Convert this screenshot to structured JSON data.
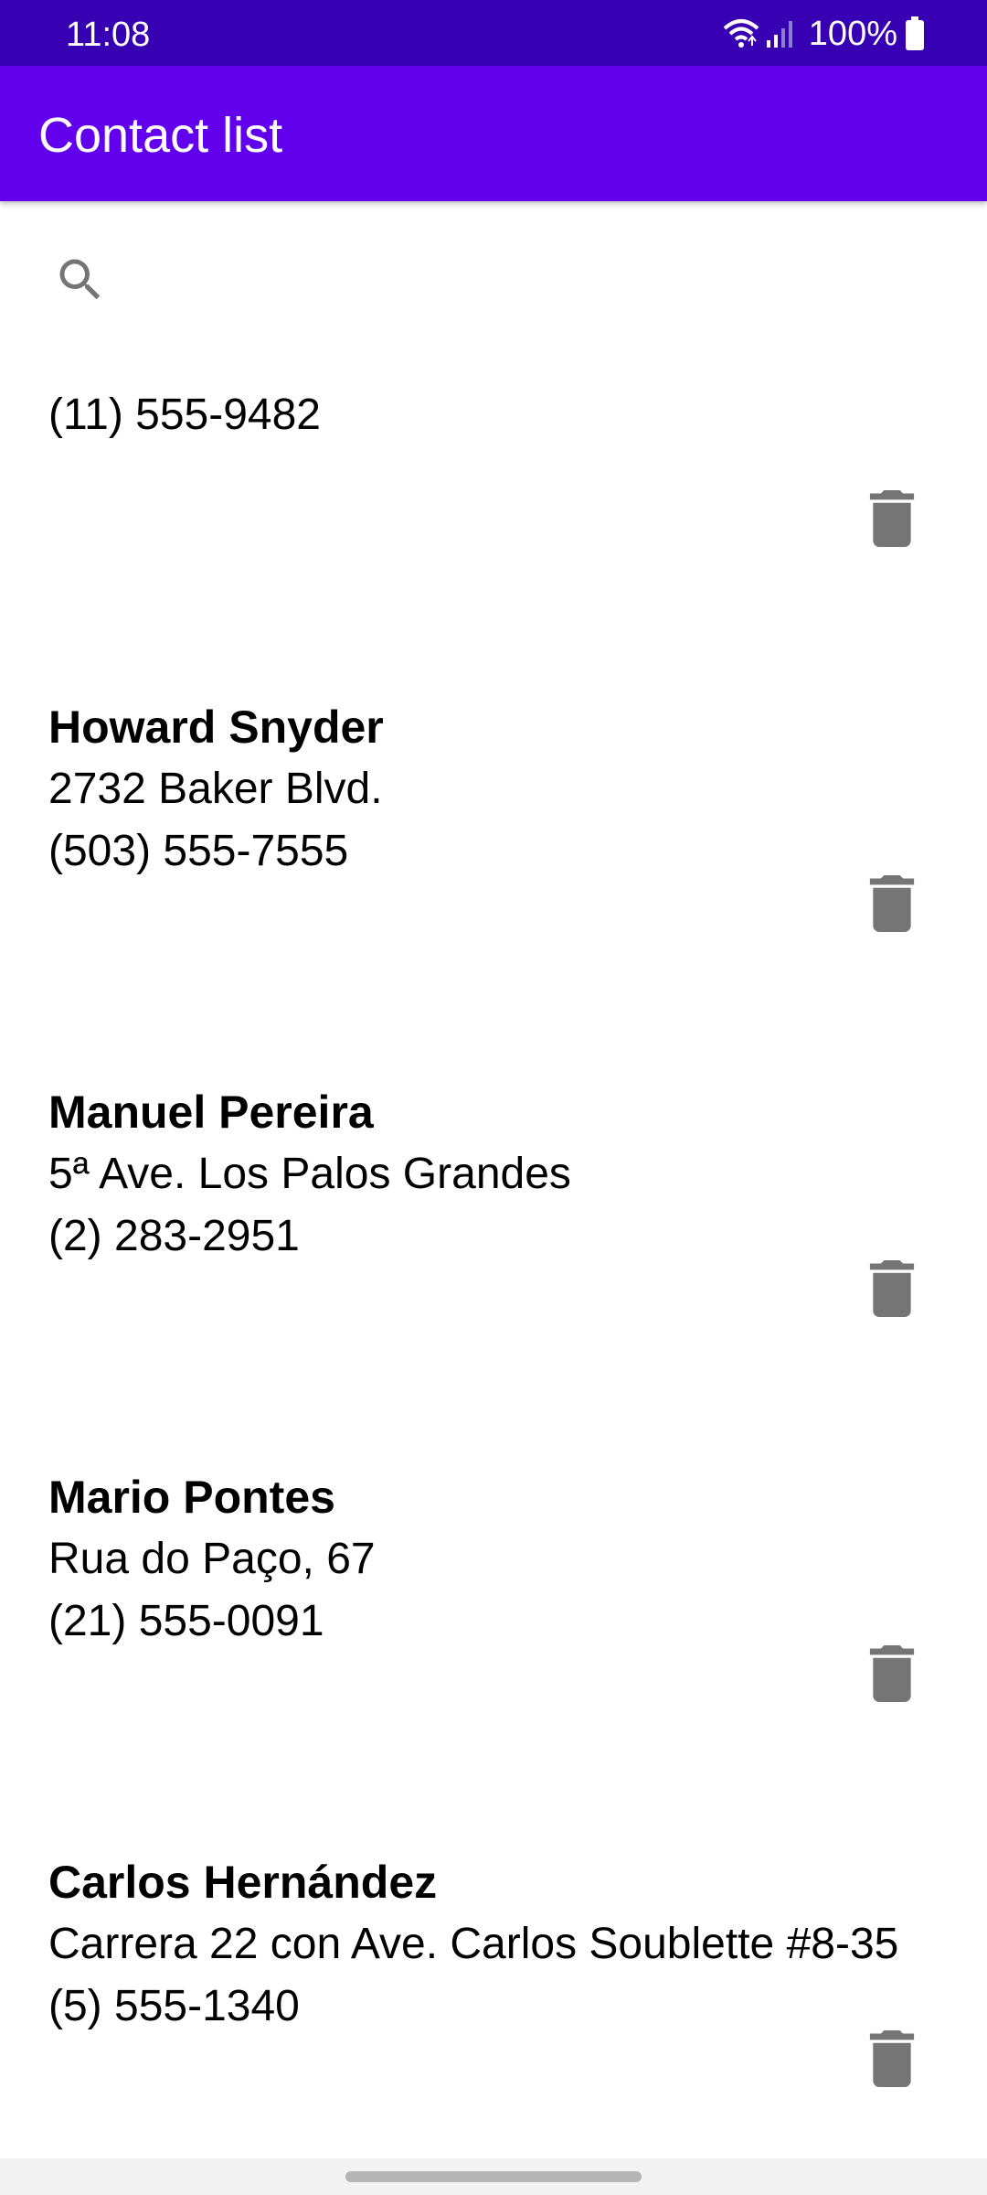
{
  "status_bar": {
    "time": "11:08",
    "battery": "100%",
    "icons": [
      "wifi-icon",
      "signal-icon",
      "battery-icon"
    ]
  },
  "app_bar": {
    "title": "Contact list",
    "color": "#6200EE",
    "status_color": "#3700B3"
  },
  "search": {
    "icon": "search-icon",
    "value": "",
    "placeholder": ""
  },
  "contacts": [
    {
      "name": "",
      "address": "",
      "phone": "(11) 555-9482"
    },
    {
      "name": "Howard Snyder",
      "address": "2732 Baker Blvd.",
      "phone": "(503) 555-7555"
    },
    {
      "name": "Manuel Pereira",
      "address": "5ª Ave. Los Palos Grandes",
      "phone": "(2) 283-2951"
    },
    {
      "name": "Mario Pontes",
      "address": "Rua do Paço, 67",
      "phone": "(21) 555-0091"
    },
    {
      "name": "Carlos Hernández",
      "address": "Carrera 22 con Ave. Carlos Soublette #8-35",
      "phone": "(5) 555-1340"
    }
  ],
  "delete_icon": "trash-icon",
  "icon_color": "#757575"
}
